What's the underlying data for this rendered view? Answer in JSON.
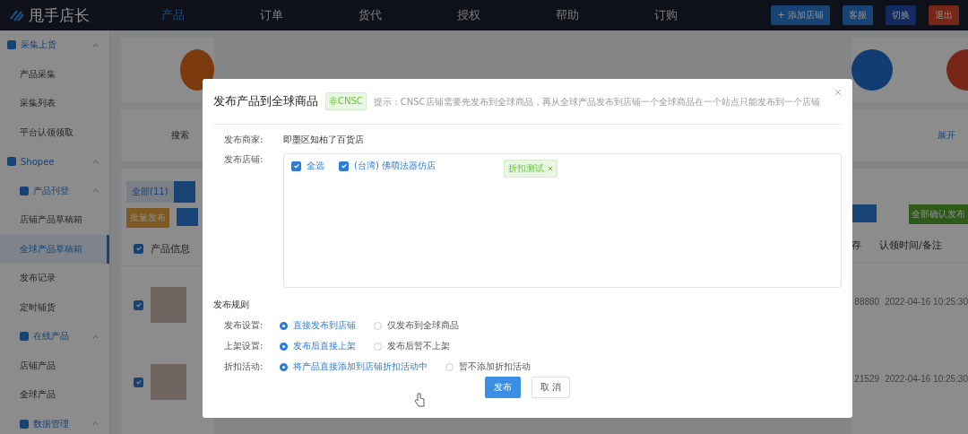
{
  "header": {
    "logo": "甩手店长",
    "nav": [
      {
        "label": "产品",
        "selected": true
      },
      {
        "label": "订单",
        "selected": false
      },
      {
        "label": "货代",
        "selected": false
      },
      {
        "label": "授权",
        "selected": false
      },
      {
        "label": "帮助",
        "selected": false
      },
      {
        "label": "订购",
        "selected": false
      }
    ],
    "actions": [
      {
        "label": "+ 添加店铺",
        "kind": "primary"
      },
      {
        "label": "客服",
        "kind": "primary"
      },
      {
        "label": "切换",
        "kind": "account"
      },
      {
        "label": "退出",
        "kind": "danger"
      }
    ]
  },
  "sidebar": {
    "items": [
      {
        "label": "采集上货",
        "expanded": true,
        "children": [
          {
            "label": "产品采集",
            "selected": false
          },
          {
            "label": "采集列表",
            "selected": false
          },
          {
            "label": "平台认领领取",
            "selected": false
          }
        ]
      },
      {
        "label": "Shopee",
        "expanded": true,
        "children": [
          {
            "label": "产品刊登",
            "expanded": true,
            "children": [
              {
                "label": "店铺产品草稿箱",
                "selected": false
              },
              {
                "label": "全球产品草稿箱",
                "selected": true
              },
              {
                "label": "发布记录",
                "selected": false
              },
              {
                "label": "定时铺货",
                "selected": false
              }
            ]
          },
          {
            "label": "在线产品",
            "expanded": true,
            "children": [
              {
                "label": "店铺产品",
                "selected": false
              },
              {
                "label": "全球产品",
                "selected": false
              }
            ]
          },
          {
            "label": "数据管理",
            "expanded": true
          }
        ]
      }
    ]
  },
  "main": {
    "filter_label": "搜索",
    "tab": "全部(11)",
    "batch_button": "批量发布",
    "right_link": "展开",
    "right_button": "全部确认发布",
    "header_checked": true,
    "columns": [
      "产品信息",
      "存",
      "认领时间/备注"
    ],
    "rows": [
      {
        "checked": true,
        "code": "88880",
        "time": "2022-04-16 10:25:30"
      },
      {
        "checked": true,
        "code": "21529",
        "time": "2022-04-16 10:25:30"
      }
    ]
  },
  "dialog": {
    "title": "发布产品到全球商品",
    "tag": "非CNSC",
    "hint": "提示：CNSC店铺需要先发布到全球商品，再从全球产品发布到店铺一个全球商品在一个站点只能发布到一个店铺",
    "merchant_label": "发布商家:",
    "merchant": "即墨区知柏了百货店",
    "store_label": "发布店铺:",
    "stores": [
      {
        "label": "全选",
        "checked": true
      },
      {
        "label": "(台湾) 佛萌法器仿店",
        "checked": true
      }
    ],
    "store_tag": "折扣测试",
    "rules_title": "发布规则",
    "rules": [
      {
        "label": "发布设置:",
        "options": [
          {
            "label": "直接发布到店铺",
            "selected": true
          },
          {
            "label": "仅发布到全球商品",
            "selected": false
          }
        ]
      },
      {
        "label": "上架设置:",
        "options": [
          {
            "label": "发布后直接上架",
            "selected": true
          },
          {
            "label": "发布后暂不上架",
            "selected": false
          }
        ]
      },
      {
        "label": "折扣活动:",
        "options": [
          {
            "label": "将产品直接添加到店铺折扣活动中",
            "selected": true
          },
          {
            "label": "暂不添加折扣活动",
            "selected": false
          }
        ]
      }
    ],
    "buttons": [
      {
        "label": "发布",
        "kind": "primary"
      },
      {
        "label": "取 消",
        "kind": "default"
      }
    ]
  }
}
